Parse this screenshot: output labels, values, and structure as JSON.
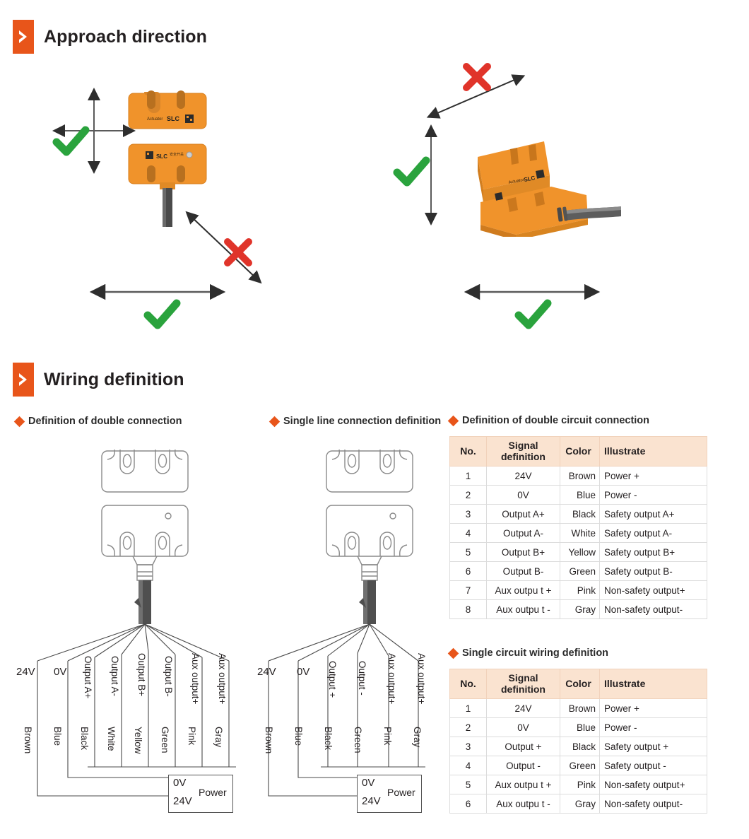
{
  "sections": [
    {
      "id": "approach",
      "title": "Approach direction",
      "icon": "chevron-right-badge-icon"
    },
    {
      "id": "wiring",
      "title": "Wiring definition",
      "icon": "chevron-right-badge-icon"
    }
  ],
  "approach": {
    "left_diagram": {
      "vertical_ok": "check-mark-icon",
      "diagonal_bad": "cross-mark-icon",
      "horizontal_ok": "check-mark-icon",
      "actuator_label": "Actuator",
      "brand": "SLC"
    },
    "right_diagram": {
      "diagonal_bad": "cross-mark-icon",
      "vertical_ok": "check-mark-icon",
      "horizontal_ok": "check-mark-icon"
    },
    "marks": {
      "ok": "✔",
      "bad": "✖"
    }
  },
  "wiring": {
    "double_conn_title": "Definition of double connection",
    "single_conn_title": "Single line connection definition",
    "double_table_title": "Definition of double circuit connection",
    "single_table_title": "Single circuit wiring definition",
    "power_box": {
      "top": "0V",
      "bottom": "24V",
      "label": "Power"
    },
    "double_diagram": {
      "rail_labels": [
        "24V",
        "0V"
      ],
      "signal_labels": [
        "Output A+",
        "Output A-",
        "Output B+",
        "Output B-",
        "Aux output+",
        "Aux output+"
      ],
      "color_labels": [
        "Brown",
        "Blue",
        "Black",
        "White",
        "Yellow",
        "Green",
        "Pink",
        "Gray"
      ]
    },
    "single_diagram": {
      "rail_labels": [
        "24V",
        "0V"
      ],
      "signal_labels": [
        "Output +",
        "Output -",
        "Aux output+",
        "Aux output+"
      ],
      "color_labels": [
        "Brown",
        "Blue",
        "Black",
        "Green",
        "Pink",
        "Gray"
      ]
    }
  },
  "tables": {
    "headers": [
      "No.",
      "Signal definition",
      "Color",
      "Illustrate"
    ],
    "header_signal_line1": "Signal",
    "header_signal_line2": "definition",
    "double": [
      {
        "no": "1",
        "signal": "24V",
        "color": "Brown",
        "illustrate": "Power +"
      },
      {
        "no": "2",
        "signal": "0V",
        "color": "Blue",
        "illustrate": "Power -"
      },
      {
        "no": "3",
        "signal": "Output A+",
        "color": "Black",
        "illustrate": "Safety output A+"
      },
      {
        "no": "4",
        "signal": "Output A-",
        "color": "White",
        "illustrate": "Safety output A-"
      },
      {
        "no": "5",
        "signal": "Output B+",
        "color": "Yellow",
        "illustrate": "Safety output B+"
      },
      {
        "no": "6",
        "signal": "Output B-",
        "color": "Green",
        "illustrate": "Safety output B-"
      },
      {
        "no": "7",
        "signal": "Aux outpu t +",
        "color": "Pink",
        "illustrate": "Non-safety output+"
      },
      {
        "no": "8",
        "signal": "Aux outpu t -",
        "color": "Gray",
        "illustrate": "Non-safety output-"
      }
    ],
    "single": [
      {
        "no": "1",
        "signal": "24V",
        "color": "Brown",
        "illustrate": "Power +"
      },
      {
        "no": "2",
        "signal": "0V",
        "color": "Blue",
        "illustrate": "Power -"
      },
      {
        "no": "3",
        "signal": "Output +",
        "color": "Black",
        "illustrate": "Safety output +"
      },
      {
        "no": "4",
        "signal": "Output -",
        "color": "Green",
        "illustrate": "Safety output -"
      },
      {
        "no": "5",
        "signal": "Aux outpu t +",
        "color": "Pink",
        "illustrate": "Non-safety output+"
      },
      {
        "no": "6",
        "signal": "Aux outpu t -",
        "color": "Gray",
        "illustrate": "Non-safety output-"
      }
    ]
  },
  "colors": {
    "brand_orange": "#e8551a",
    "table_header_bg": "#fae3d0",
    "check_green": "#2aa33d",
    "cross_red": "#e0342a",
    "product_orange": "#f0932b"
  }
}
